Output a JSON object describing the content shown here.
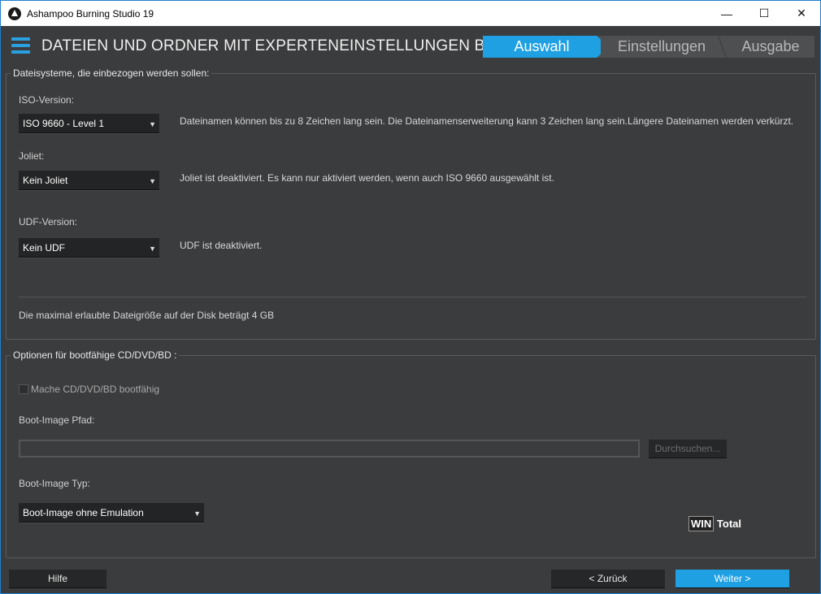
{
  "window": {
    "title": "Ashampoo Burning Studio 19",
    "minimize": "—",
    "maximize": "☐",
    "close": "✕"
  },
  "header": {
    "title": "DATEIEN UND ORDNER MIT EXPERTENEINSTELLUNGEN BREN...",
    "steps": [
      {
        "label": "Auswahl",
        "active": true
      },
      {
        "label": "Einstellungen"
      },
      {
        "label": "Ausgabe"
      }
    ]
  },
  "filesystems": {
    "legend": "Dateisysteme, die einbezogen werden sollen:",
    "iso": {
      "label": "ISO-Version:",
      "value": "ISO 9660 - Level 1",
      "desc": "Dateinamen können bis zu 8 Zeichen lang sein. Die Dateinamenserweiterung kann 3 Zeichen lang sein.Längere Dateinamen werden verkürzt."
    },
    "joliet": {
      "label": "Joliet:",
      "value": "Kein Joliet",
      "desc": "Joliet ist deaktiviert. Es kann nur aktiviert werden, wenn auch ISO 9660 ausgewählt ist."
    },
    "udf": {
      "label": "UDF-Version:",
      "value": "Kein UDF",
      "desc": "UDF ist deaktiviert."
    },
    "max_size": "Die maximal erlaubte Dateigröße auf der Disk beträgt 4 GB"
  },
  "boot": {
    "legend": "Optionen für bootfähige CD/DVD/BD :",
    "checkbox_label": "Mache CD/DVD/BD bootfähig",
    "checked": false,
    "path_label": "Boot-Image Pfad:",
    "path_value": "",
    "browse": "Durchsuchen...",
    "type_label": "Boot-Image Typ:",
    "type_value": "Boot-Image ohne Emulation"
  },
  "watermark": {
    "a": "WIN",
    "b": "Total"
  },
  "footer": {
    "help": "Hilfe",
    "back": "< Zurück",
    "next": "Weiter >"
  },
  "arrow": "▼"
}
